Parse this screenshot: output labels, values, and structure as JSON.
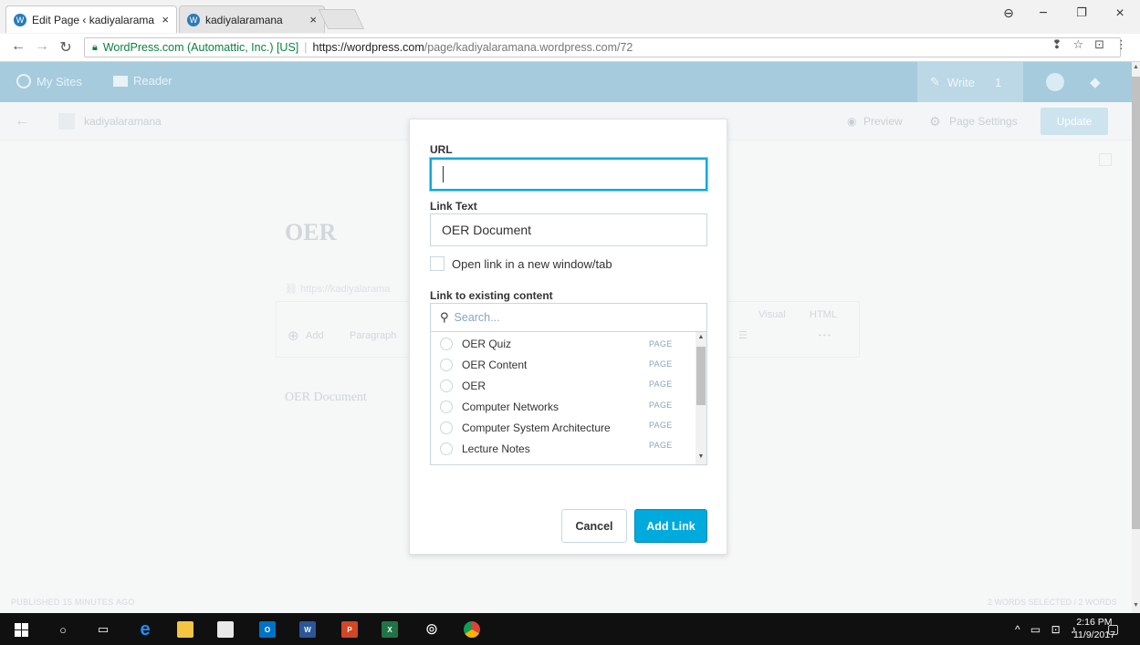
{
  "browser": {
    "tabs": [
      {
        "title": "Edit Page ‹ kadiyalaraman",
        "close": "×"
      },
      {
        "title": "kadiyalaramana",
        "close": "×"
      }
    ],
    "window_controls": [
      "−",
      "❐",
      "×"
    ],
    "address": {
      "secure_label": "WordPress.com (Automattic, Inc.) [US]",
      "url_host": "https://wordpress.com",
      "url_path": "/page/kadiyalaramana.wordpress.com/72"
    }
  },
  "masterbar": {
    "my_sites": "My Sites",
    "reader": "Reader",
    "write": "Write",
    "write_count": "1"
  },
  "editor_bar": {
    "site_name": "kadiyalaramana",
    "preview": "Preview",
    "page_settings": "Page Settings",
    "update": "Update"
  },
  "editor": {
    "page_title": "OER",
    "permalink": "https://kadiyalarama",
    "toolbar": {
      "add": "Add",
      "paragraph": "Paragraph",
      "visual": "Visual",
      "html": "HTML",
      "more": "• • •"
    },
    "content": "OER Document",
    "status_left": "PUBLISHED 15 MINUTES AGO",
    "status_right": "2 WORDS SELECTED / 2 WORDS"
  },
  "link_dialog": {
    "url_label": "URL",
    "url_value": "",
    "link_text_label": "Link Text",
    "link_text_value": "OER Document",
    "new_window_label": "Open link in a new window/tab",
    "existing_label": "Link to existing content",
    "search_placeholder": "Search...",
    "results": [
      {
        "title": "OER Quiz",
        "type": "PAGE"
      },
      {
        "title": "OER Content",
        "type": "PAGE"
      },
      {
        "title": "OER",
        "type": "PAGE"
      },
      {
        "title": "Computer Networks",
        "type": "PAGE"
      },
      {
        "title": "Computer System Architecture",
        "type": "PAGE"
      },
      {
        "title": "Lecture Notes",
        "type": "PAGE"
      }
    ],
    "cancel": "Cancel",
    "add_link": "Add Link"
  },
  "taskbar": {
    "time": "2:16 PM",
    "date": "11/9/2017"
  },
  "colors": {
    "accent": "#00aadc",
    "masterbar": "#a5cbdd",
    "taskbar": "#101010"
  }
}
